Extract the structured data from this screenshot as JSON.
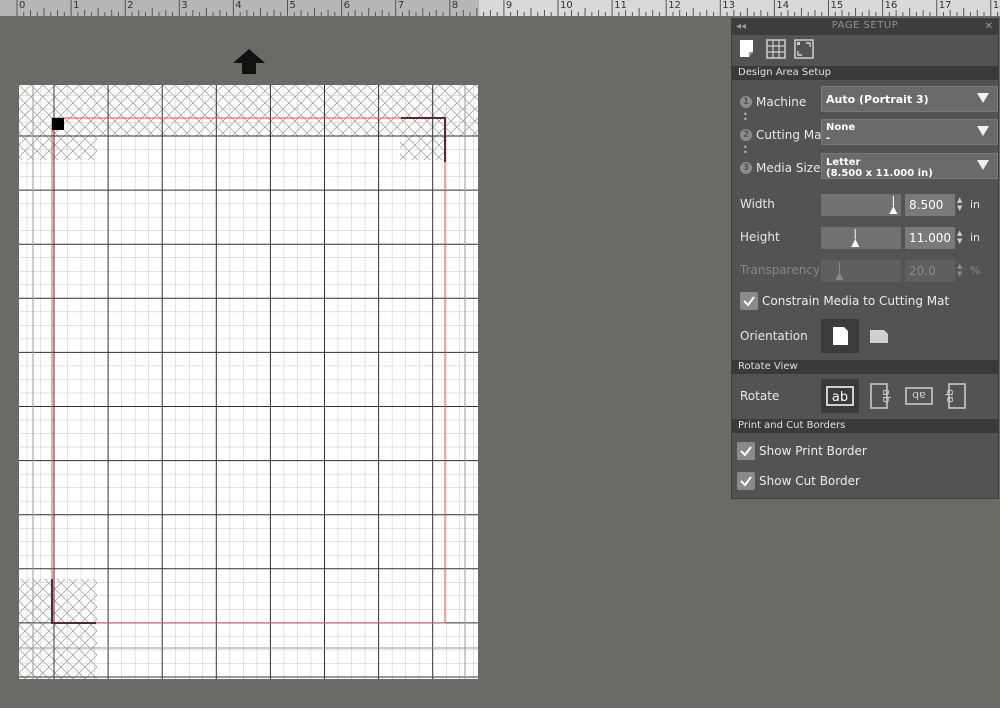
{
  "ruler": {
    "numbers": [
      "0",
      "1",
      "2",
      "3",
      "4",
      "5",
      "6",
      "7",
      "8",
      "9",
      "10",
      "11",
      "12",
      "13",
      "14",
      "15",
      "16",
      "17",
      "18"
    ]
  },
  "panel": {
    "title": "PAGE SETUP",
    "collapse_glyph": "◂◂",
    "close_glyph": "✕",
    "tabs": [
      {
        "icon": "page-setup-icon",
        "active": true
      },
      {
        "icon": "grid-icon",
        "active": false
      },
      {
        "icon": "registration-icon",
        "active": false
      }
    ],
    "design_area": {
      "header": "Design Area Setup",
      "machine": {
        "step": "1",
        "label": "Machine",
        "value": "Auto (Portrait 3)"
      },
      "cutting_mat": {
        "step": "2",
        "label": "Cutting Mat",
        "value": "None",
        "subvalue": "-"
      },
      "media_size": {
        "step": "3",
        "label": "Media Size",
        "value": "Letter",
        "subvalue": "(8.500 x 11.000 in)"
      },
      "width": {
        "label": "Width",
        "value": "8.500",
        "unit": "in",
        "slider_level": 0.95
      },
      "height": {
        "label": "Height",
        "value": "11.000",
        "unit": "in",
        "slider_level": 0.42
      },
      "transparency": {
        "label": "Transparency",
        "value": "20.0",
        "unit": "%",
        "slider_level": 0.2,
        "disabled": true
      },
      "constrain": {
        "label": "Constrain Media to Cutting Mat",
        "checked": true
      },
      "orientation": {
        "label": "Orientation",
        "selected": "portrait"
      }
    },
    "rotate_view": {
      "header": "Rotate View",
      "label": "Rotate",
      "options": [
        "ab",
        "ab",
        "ab",
        "ab"
      ]
    },
    "borders": {
      "header": "Print and Cut Borders",
      "show_print": {
        "label": "Show Print Border",
        "checked": true
      },
      "show_cut": {
        "label": "Show Cut Border",
        "checked": true
      }
    }
  },
  "colors": {
    "workspace": "#6b6a67",
    "panel": "#535353",
    "cut_border": "#e05050",
    "registration": "#5a2a2a"
  }
}
